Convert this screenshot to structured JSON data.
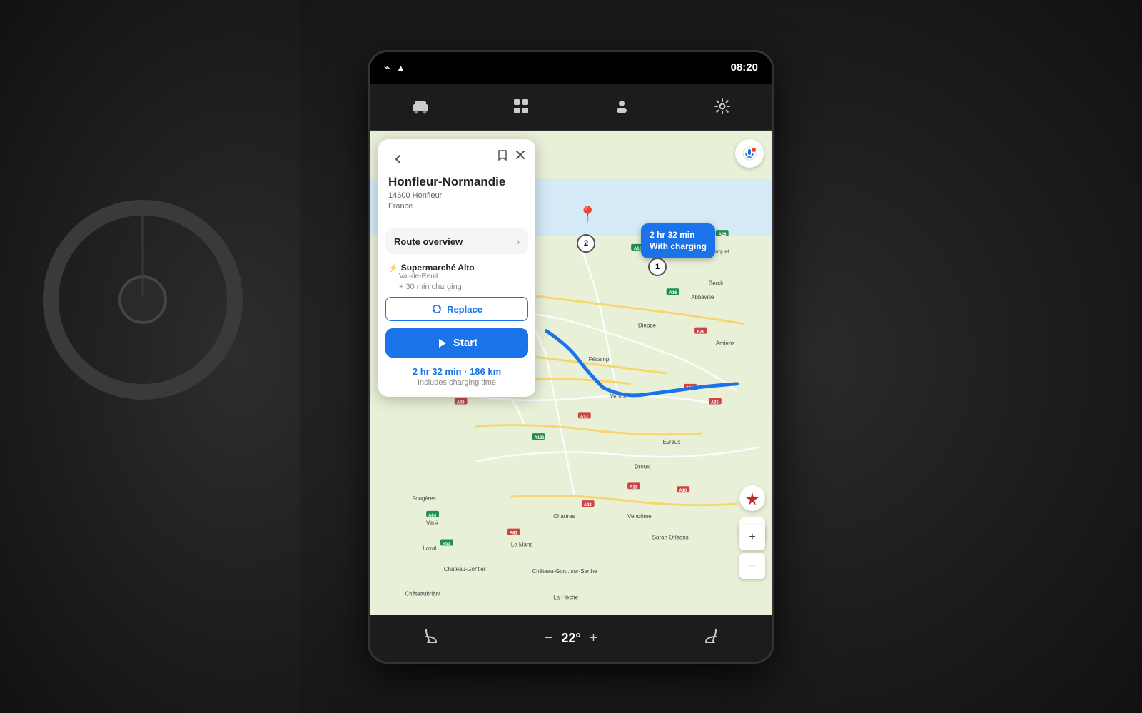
{
  "status_bar": {
    "wifi_icon": "wifi",
    "nav_icon": "navigation",
    "time": "08:20"
  },
  "nav_bar": {
    "car_icon": "🚗",
    "grid_icon": "⊞",
    "person_icon": "👤",
    "gear_icon": "⚙"
  },
  "map": {
    "tooltip": {
      "line1": "2 hr 32 min",
      "line2": "With charging"
    },
    "marker1_label": "1",
    "marker2_label": "2",
    "mic_icon": "🎙",
    "location_icon": "◎",
    "speed_icon": "⚡",
    "zoom_in": "+",
    "zoom_out": "−"
  },
  "route_card": {
    "back_icon": "←",
    "bookmark_icon": "🔖",
    "close_icon": "✕",
    "destination_name": "Honfleur-Normandie",
    "destination_address_line1": "14600 Honfleur",
    "destination_address_line2": "France",
    "route_overview_label": "Route overview",
    "chevron": "›",
    "charging_stop": {
      "icon": "⚡",
      "name": "Supermarché Alto",
      "location": "Val-de-Reuil",
      "time_prefix": "+",
      "time": "30 min charging"
    },
    "replace_icon": "🔄",
    "replace_label": "Replace",
    "start_icon": "▲",
    "start_label": "Start",
    "trip_time": "2 hr 32 min · 186 km",
    "trip_includes": "Includes charging time"
  },
  "bottom_bar": {
    "seat_left_icon": "🪑",
    "temp_minus": "−",
    "temp_value": "22°",
    "temp_plus": "+",
    "seat_right_icon": "🪑"
  }
}
